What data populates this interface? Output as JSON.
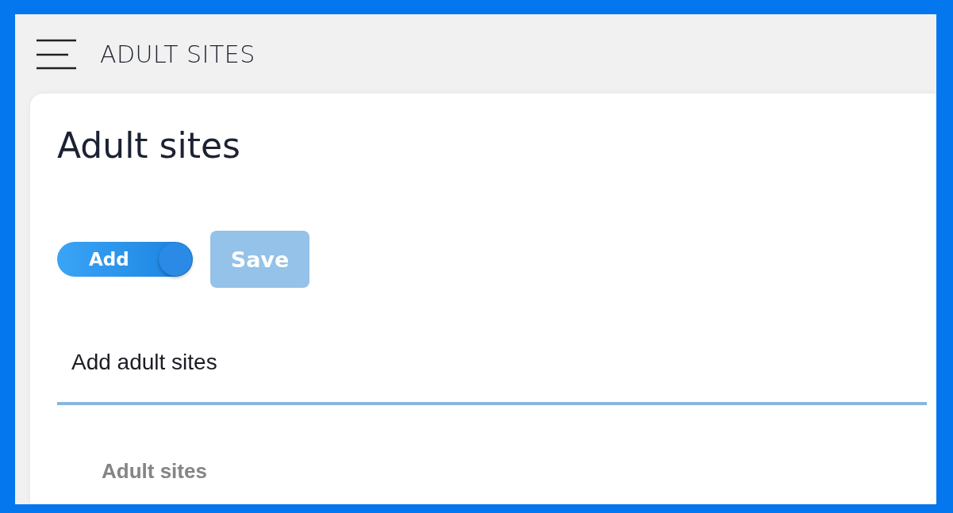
{
  "header": {
    "title": "ADULT SITES"
  },
  "page": {
    "heading": "Adult sites"
  },
  "toggle": {
    "label": "Add",
    "on": true
  },
  "save_button": {
    "label": "Save",
    "disabled": true
  },
  "site_field": {
    "placeholder": "Add adult sites"
  },
  "list": {
    "heading": "Adult sites"
  }
}
